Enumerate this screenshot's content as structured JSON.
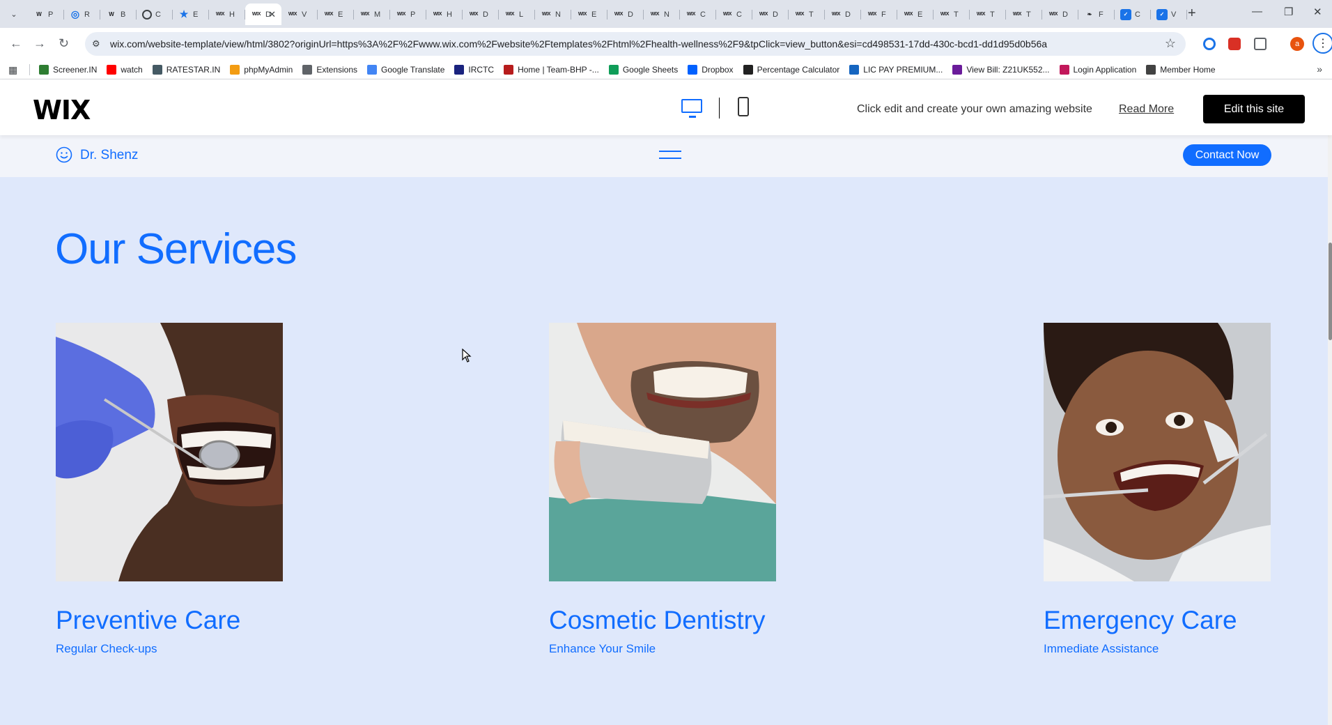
{
  "browser": {
    "tabs": [
      {
        "icon": "wikipedia-icon",
        "letter": "P"
      },
      {
        "icon": "globe-icon",
        "letter": "R"
      },
      {
        "icon": "wikipedia-icon",
        "letter": "B"
      },
      {
        "icon": "circle-icon",
        "letter": "C"
      },
      {
        "icon": "star-icon",
        "letter": "E"
      },
      {
        "icon": "wix-icon",
        "letter": "H"
      },
      {
        "icon": "wix-icon",
        "letter": "D",
        "active": true
      },
      {
        "icon": "wix-icon",
        "letter": "V"
      },
      {
        "icon": "wix-icon",
        "letter": "E"
      },
      {
        "icon": "wix-icon",
        "letter": "M"
      },
      {
        "icon": "wix-icon",
        "letter": "P"
      },
      {
        "icon": "wix-icon",
        "letter": "H"
      },
      {
        "icon": "wix-icon",
        "letter": "D"
      },
      {
        "icon": "wix-icon",
        "letter": "L"
      },
      {
        "icon": "wix-icon",
        "letter": "N"
      },
      {
        "icon": "wix-icon",
        "letter": "E"
      },
      {
        "icon": "wix-icon",
        "letter": "D"
      },
      {
        "icon": "wix-icon",
        "letter": "N"
      },
      {
        "icon": "wix-icon",
        "letter": "C"
      },
      {
        "icon": "wix-icon",
        "letter": "C"
      },
      {
        "icon": "wix-icon",
        "letter": "D"
      },
      {
        "icon": "wix-icon",
        "letter": "T"
      },
      {
        "icon": "wix-icon",
        "letter": "D"
      },
      {
        "icon": "wix-icon",
        "letter": "F"
      },
      {
        "icon": "wix-icon",
        "letter": "E"
      },
      {
        "icon": "wix-icon",
        "letter": "T"
      },
      {
        "icon": "wix-icon",
        "letter": "T"
      },
      {
        "icon": "wix-icon",
        "letter": "T"
      },
      {
        "icon": "wix-icon",
        "letter": "D"
      },
      {
        "icon": "feather-icon",
        "letter": "F"
      },
      {
        "icon": "blue-icon",
        "letter": "C"
      },
      {
        "icon": "blue-icon",
        "letter": "V"
      }
    ],
    "url": "wix.com/website-template/view/html/3802?originUrl=https%3A%2F%2Fwww.wix.com%2Fwebsite%2Ftemplates%2Fhtml%2Fhealth-wellness%2F9&tpClick=view_button&esi=cd498531-17dd-430c-bcd1-dd1d95d0b56a",
    "profile_initial": "a",
    "bookmarks": [
      {
        "label": "Screener.IN",
        "icon": "bar-chart-icon",
        "color": "#2e7d32"
      },
      {
        "label": "watch",
        "icon": "youtube-icon",
        "color": "#ff0000"
      },
      {
        "label": "RATESTAR.IN",
        "icon": "star-icon",
        "color": "#455a64"
      },
      {
        "label": "phpMyAdmin",
        "icon": "php-icon",
        "color": "#f39c12"
      },
      {
        "label": "Extensions",
        "icon": "puzzle-icon",
        "color": "#5f6368"
      },
      {
        "label": "Google Translate",
        "icon": "translate-icon",
        "color": "#4285f4"
      },
      {
        "label": "IRCTC",
        "icon": "train-icon",
        "color": "#1a237e"
      },
      {
        "label": "Home | Team-BHP -...",
        "icon": "bhp-icon",
        "color": "#b71c1c"
      },
      {
        "label": "Google Sheets",
        "icon": "sheets-icon",
        "color": "#0f9d58"
      },
      {
        "label": "Dropbox",
        "icon": "dropbox-icon",
        "color": "#0061ff"
      },
      {
        "label": "Percentage Calculator",
        "icon": "percent-icon",
        "color": "#212121"
      },
      {
        "label": "LIC PAY PREMIUM...",
        "icon": "lic-icon",
        "color": "#1565c0"
      },
      {
        "label": "View Bill: Z21UK552...",
        "icon": "bill-icon",
        "color": "#6a1b9a"
      },
      {
        "label": "Login Application",
        "icon": "login-icon",
        "color": "#c2185b"
      },
      {
        "label": "Member Home",
        "icon": "globe-icon",
        "color": "#424242"
      }
    ]
  },
  "wix_bar": {
    "logo": "WIX",
    "message": "Click edit and create your own amazing website",
    "read_more": "Read More",
    "edit_button": "Edit this site"
  },
  "site": {
    "name": "Dr. Shenz",
    "contact_button": "Contact Now",
    "accent_color": "#116dff",
    "section_title": "Our Services",
    "services": [
      {
        "title": "Preventive Care",
        "subtitle": "Regular Check-ups",
        "image": "dentist-checkup-photo"
      },
      {
        "title": "Cosmetic Dentistry",
        "subtitle": "Enhance Your Smile",
        "image": "tooth-shade-guide-photo"
      },
      {
        "title": "Emergency Care",
        "subtitle": "Immediate Assistance",
        "image": "child-dental-exam-photo"
      }
    ]
  }
}
